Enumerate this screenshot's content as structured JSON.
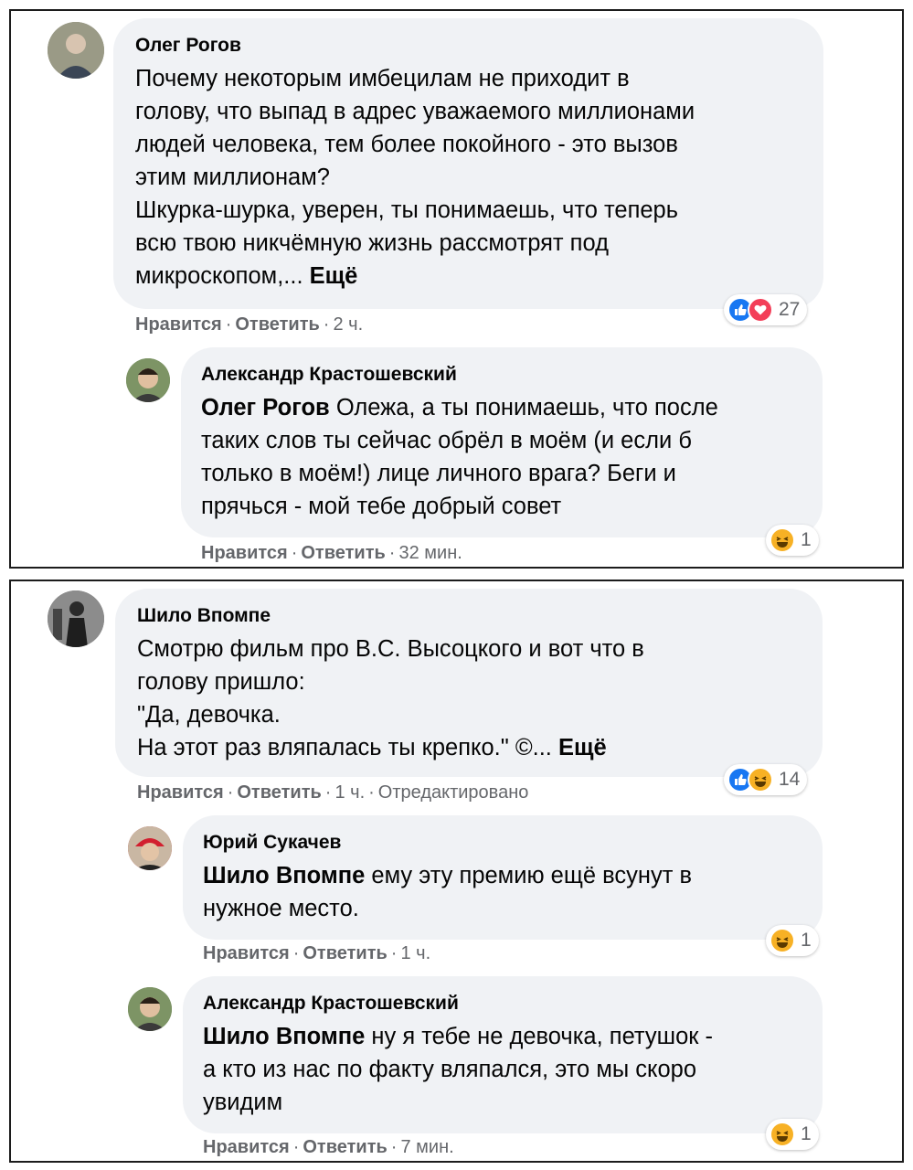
{
  "threads": [
    {
      "comment": {
        "author": "Олег Рогов",
        "lines": [
          "Почему некоторым имбецилам не приходит в",
          "голову, что выпад в адрес уважаемого миллионами",
          "людей человека, тем более покойного - это вызов",
          "этим миллионам?",
          "Шкурка-шурка, уверен, ты понимаешь, что теперь",
          "всю твою никчёмную жизнь рассмотрят под"
        ],
        "last_line": "микроскопом,... ",
        "more": "Ещё",
        "like": "Нравится",
        "reply": "Ответить",
        "time": "2 ч.",
        "reactions": {
          "icons": [
            "like-icon",
            "love-icon"
          ],
          "count": "27"
        }
      },
      "reply": {
        "author": "Александр Крастошевский",
        "mention": "Олег Рогов",
        "first_line": " Олежа, а ты понимаешь, что после",
        "lines": [
          "таких слов ты сейчас обрёл в моём (и если б",
          "только в моём!) лице личного врага? Беги и",
          "прячься - мой тебе добрый совет"
        ],
        "like": "Нравится",
        "reply": "Ответить",
        "time": "32 мин.",
        "reactions": {
          "icons": [
            "haha-icon"
          ],
          "count": "1"
        }
      }
    },
    {
      "comment": {
        "author": "Шило Впомпе",
        "lines": [
          "Смотрю фильм про В.С. Высоцкого и вот что в",
          "голову пришло:",
          "\"Да, девочка."
        ],
        "last_line": "На этот раз вляпалась ты крепко.\" ©... ",
        "more": "Ещё",
        "like": "Нравится",
        "reply": "Ответить",
        "time": "1 ч.",
        "edited": "Отредактировано",
        "reactions": {
          "icons": [
            "like-icon",
            "haha-icon"
          ],
          "count": "14"
        }
      },
      "replies": [
        {
          "author": "Юрий Сукачев",
          "mention": "Шило Впомпе",
          "first_line": " ему эту премию ещё всунут в",
          "lines": [
            "нужное место."
          ],
          "like": "Нравится",
          "reply": "Ответить",
          "time": "1 ч.",
          "reactions": {
            "icons": [
              "haha-icon"
            ],
            "count": "1"
          }
        },
        {
          "author": "Александр Крастошевский",
          "mention": "Шило Впомпе",
          "first_line": " ну я тебе не девочка, петушок -",
          "lines": [
            "а кто из нас по факту вляпался, это мы скоро",
            "увидим"
          ],
          "like": "Нравится",
          "reply": "Ответить",
          "time": "7 мин.",
          "reactions": {
            "icons": [
              "haha-icon"
            ],
            "count": "1"
          }
        }
      ]
    }
  ],
  "colors": {
    "bubble": "#f0f2f5",
    "meta_text": "#65676b",
    "like_blue": "#1877f2",
    "love_red": "#f33e58",
    "haha_yellow": "#f7b125"
  }
}
